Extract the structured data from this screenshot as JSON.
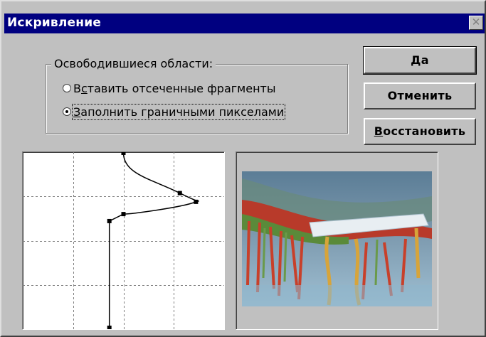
{
  "dialog": {
    "title": "Искривление",
    "close_glyph": "✕"
  },
  "options": {
    "group_label": "Освободившиеся области:",
    "radios": [
      {
        "pre": "В",
        "accel": "с",
        "post": "тавить отсеченные фрагменты",
        "checked": false
      },
      {
        "pre": "",
        "accel": "З",
        "post": "аполнить граничными пикселами",
        "checked": true
      }
    ]
  },
  "buttons": {
    "ok": "Да",
    "cancel": "Отменить",
    "restore_accel": "В",
    "restore_rest": "осстановить"
  },
  "curve": {
    "grid_divisions": 4,
    "points": [
      {
        "x": 0.5,
        "y": 0.0
      },
      {
        "x": 0.78,
        "y": 0.23
      },
      {
        "x": 0.86,
        "y": 0.28
      },
      {
        "x": 0.5,
        "y": 0.35
      },
      {
        "x": 0.43,
        "y": 0.39
      },
      {
        "x": 0.43,
        "y": 1.0
      }
    ]
  },
  "colors": {
    "face": "#c0c0c0",
    "title_bar": "#000080"
  },
  "icons": {
    "close": "close-icon",
    "preview": "distorted-image-preview"
  }
}
